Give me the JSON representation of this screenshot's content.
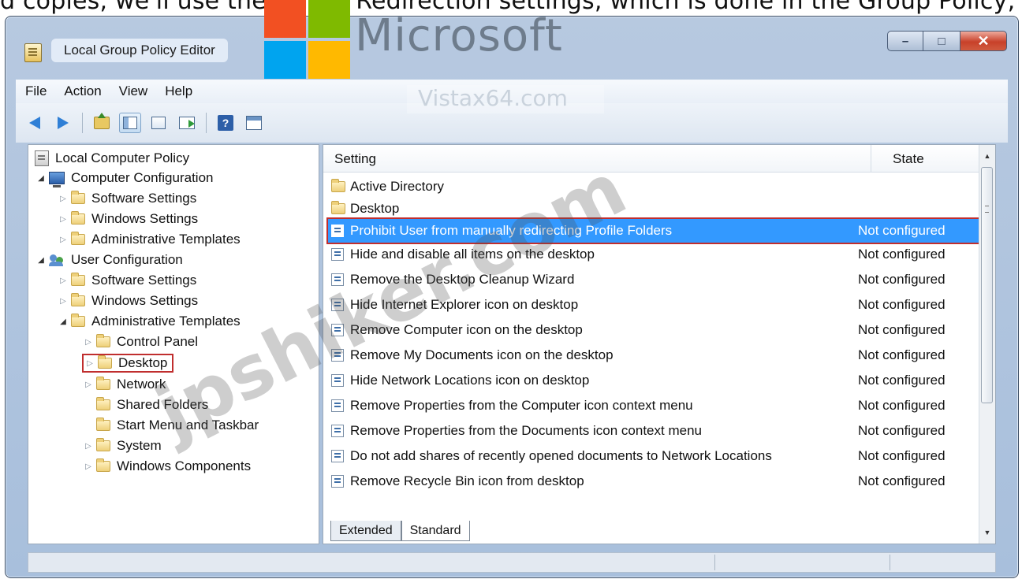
{
  "top_strip_text": "d copies, we'll use the Folder Redirection settings, which is done in the Group Policy, so let's use Group Policy:",
  "window": {
    "title": "Local Group Policy Editor",
    "minimize_glyph": "–",
    "maximize_glyph": "□",
    "close_glyph": "✕"
  },
  "watermarks": {
    "brand": "Microsoft",
    "site": "Vistax64.com",
    "overlay": "jpshiker.com"
  },
  "menu": {
    "file": "File",
    "action": "Action",
    "view": "View",
    "help": "Help"
  },
  "toolbar": {
    "help_glyph": "?"
  },
  "tree": {
    "root": "Local Computer Policy",
    "computer_config": "Computer Configuration",
    "cc_software": "Software Settings",
    "cc_windows": "Windows Settings",
    "cc_admin": "Administrative Templates",
    "user_config": "User Configuration",
    "uc_software": "Software Settings",
    "uc_windows": "Windows Settings",
    "uc_admin": "Administrative Templates",
    "control_panel": "Control Panel",
    "desktop": "Desktop",
    "network": "Network",
    "shared_folders": "Shared Folders",
    "start_menu": "Start Menu and Taskbar",
    "system": "System",
    "windows_components": "Windows Components"
  },
  "list": {
    "col_setting": "Setting",
    "col_state": "State",
    "folders": [
      "Active Directory",
      "Desktop"
    ],
    "rows": [
      {
        "setting": "Prohibit User from manually redirecting Profile Folders",
        "state": "Not configured",
        "selected": true
      },
      {
        "setting": "Hide and disable all items on the desktop",
        "state": "Not configured"
      },
      {
        "setting": "Remove the Desktop Cleanup Wizard",
        "state": "Not configured"
      },
      {
        "setting": "Hide Internet Explorer icon on desktop",
        "state": "Not configured"
      },
      {
        "setting": "Remove Computer icon on the desktop",
        "state": "Not configured"
      },
      {
        "setting": "Remove My Documents icon on the desktop",
        "state": "Not configured"
      },
      {
        "setting": "Hide Network Locations icon on desktop",
        "state": "Not configured"
      },
      {
        "setting": "Remove Properties from the Computer icon context menu",
        "state": "Not configured"
      },
      {
        "setting": "Remove Properties from the Documents icon context menu",
        "state": "Not configured"
      },
      {
        "setting": "Do not add shares of recently opened documents to Network Locations",
        "state": "Not configured"
      },
      {
        "setting": "Remove Recycle Bin icon from desktop",
        "state": "Not configured"
      }
    ]
  },
  "tabs": {
    "extended": "Extended",
    "standard": "Standard"
  },
  "colors": {
    "selection": "#3399ff",
    "annotation_border": "#c02e2e",
    "window_frame": "#b7c9e0"
  }
}
